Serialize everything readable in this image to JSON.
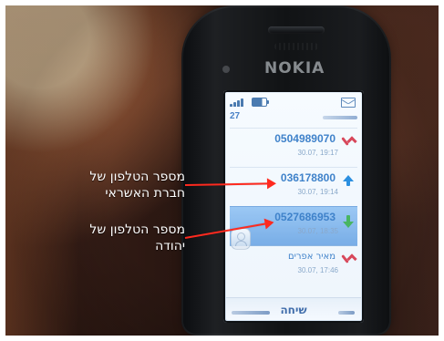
{
  "phone": {
    "brand": "NOKIA",
    "status_count": "27",
    "softkey_center": "שיחה"
  },
  "call_entries": [
    {
      "main": "0504989070",
      "time": "30.07, 19:17",
      "call_type": "missed",
      "selected": false
    },
    {
      "main": "036178800",
      "time": "30.07, 19:14",
      "call_type": "dialed",
      "selected": false
    },
    {
      "main": "0527686953",
      "time": "30.07, 18:35",
      "call_type": "received",
      "selected": true
    },
    {
      "main": "מאיר אפרים",
      "time": "30.07, 17:46",
      "call_type": "missed",
      "selected": false
    }
  ],
  "annotations": {
    "credit_company": {
      "line1": "מספר הטלפון של",
      "line2": "חברת האשראי"
    },
    "yehuda": {
      "line1": "מספר הטלפון של",
      "line2": "יהודה"
    },
    "arrow_color": "#ff2a1f"
  },
  "icons": {
    "signal": "signal-bars-icon",
    "battery": "battery-icon",
    "mail": "mail-icon",
    "missed_call": "missed-call-icon",
    "dialed_call": "dialed-call-icon",
    "received_call": "received-call-icon",
    "contact": "contact-photo-icon"
  },
  "colors": {
    "call_number": "#3f82ca",
    "selected_row": "#7db5ec",
    "missed_call": "#d8485b",
    "dialed_call": "#2b8fe0",
    "received_call": "#48b562",
    "annotation_text": "#ffffff"
  }
}
